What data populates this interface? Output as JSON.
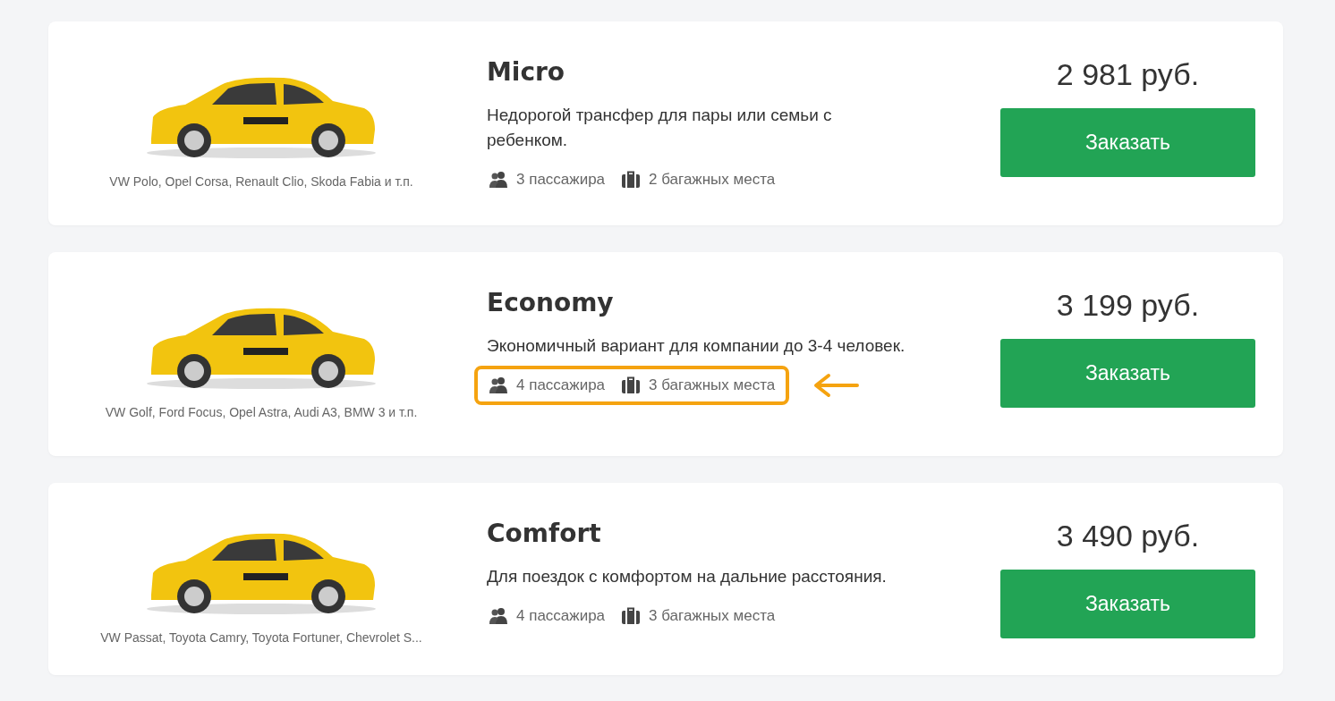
{
  "cards": [
    {
      "models": "VW Polo, Opel Corsa, Renault Clio, Skoda Fabia и т.п.",
      "title": "Micro",
      "description": "Недорогой трансфер для пары или семьи с ребенком.",
      "passengers": "3 пассажира",
      "luggage": "2 багажных места",
      "highlighted": false,
      "price": "2 981 руб.",
      "button": "Заказать"
    },
    {
      "models": "VW Golf, Ford Focus, Opel Astra, Audi A3, BMW 3 и т.п.",
      "title": "Economy",
      "description": "Экономичный вариант для компании до 3-4 человек.",
      "passengers": "4 пассажира",
      "luggage": "3 багажных места",
      "highlighted": true,
      "price": "3 199 руб.",
      "button": "Заказать"
    },
    {
      "models": "VW Passat, Toyota Camry, Toyota Fortuner, Chevrolet S...",
      "title": "Comfort",
      "description": "Для поездок с комфортом на дальние расстояния.",
      "passengers": "4 пассажира",
      "luggage": "3 багажных места",
      "highlighted": false,
      "price": "3 490 руб.",
      "button": "Заказать"
    }
  ]
}
